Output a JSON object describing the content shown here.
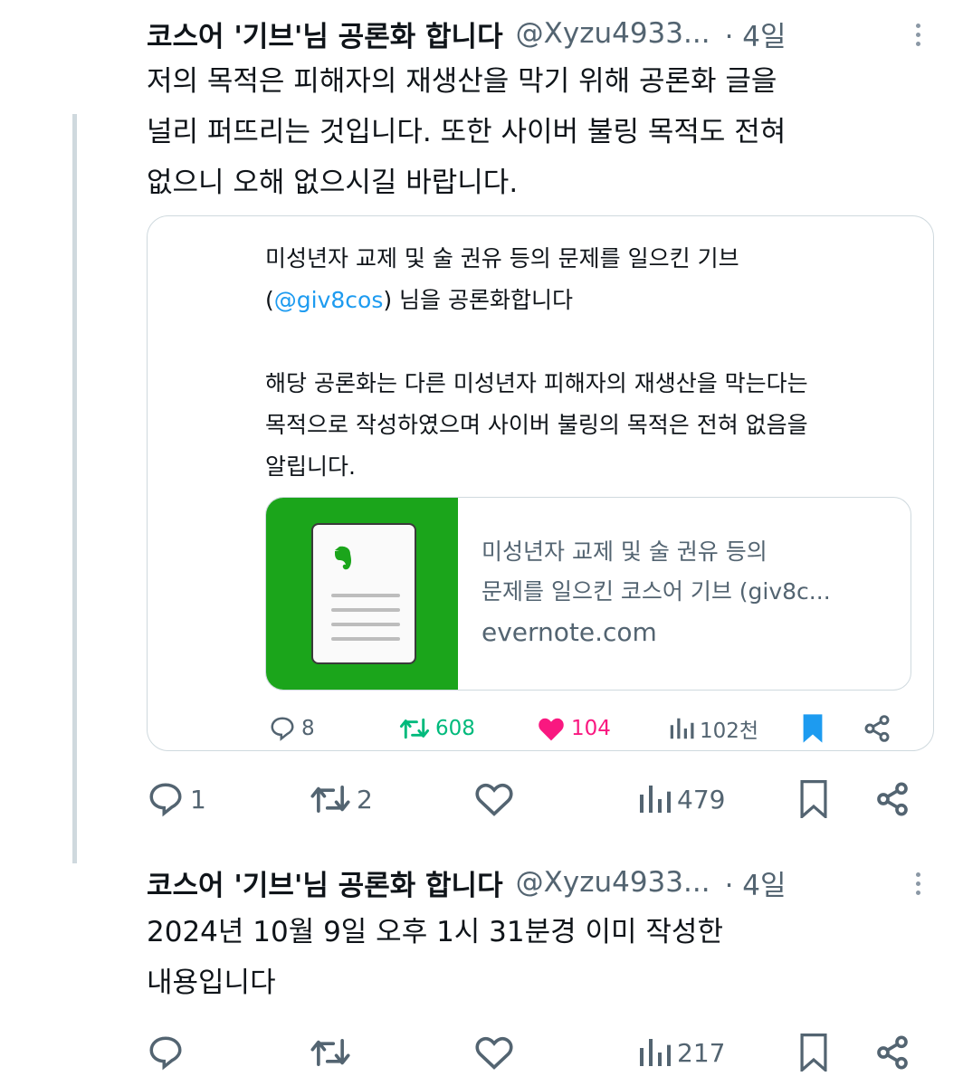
{
  "tweets": [
    {
      "author_name": "코스어 '기브'님 공론화 합니다",
      "author_handle": "@Xyzu4933...",
      "time": "· 4일",
      "body": "저의 목적은 피해자의 재생산을 막기 위해 공론화 글을\n널리 퍼뜨리는 것입니다. 또한 사이버 불링 목적도 전혀\n없으니 오해 없으시길 바랍니다.",
      "quote": {
        "line1": "미성년자 교제 및 술 권유 등의 문제를 일으킨 기브",
        "line2_prefix": "(",
        "mention": "@giv8cos",
        "line2_suffix": ") 님을 공론화합니다",
        "paragraph": "해당 공론화는 다른 미성년자 피해자의 재생산을 막는다는\n목적으로 작성하였으며 사이버 불링의 목적은 전혀 없음을\n알립니다.",
        "link_title": "미성년자 교제 및 술 권유 등의\n문제를 일으킨 코스어 기브 (giv8c...",
        "link_domain": "evernote.com",
        "replies": "8",
        "retweets": "608",
        "likes": "104",
        "views": "102천"
      },
      "replies": "1",
      "retweets": "2",
      "views": "479"
    },
    {
      "author_name": "코스어 '기브'님 공론화 합니다",
      "author_handle": "@Xyzu4933...",
      "time": "· 4일",
      "body": "2024년 10월 9일 오후 1시 31분경 이미 작성한\n내용입니다",
      "views": "217"
    }
  ],
  "colors": {
    "text_primary": "#0f1419",
    "text_secondary": "#536471",
    "mention": "#1d9bf0",
    "retweet_active": "#00ba7c",
    "like_active": "#f91880",
    "bookmark_active": "#1d9bf0",
    "evernote_green": "#1ba51b",
    "border": "#cfd9de"
  },
  "icons": [
    "reply-icon",
    "retweet-icon",
    "like-icon",
    "views-icon",
    "bookmark-icon",
    "share-icon",
    "more-icon",
    "evernote-icon"
  ]
}
